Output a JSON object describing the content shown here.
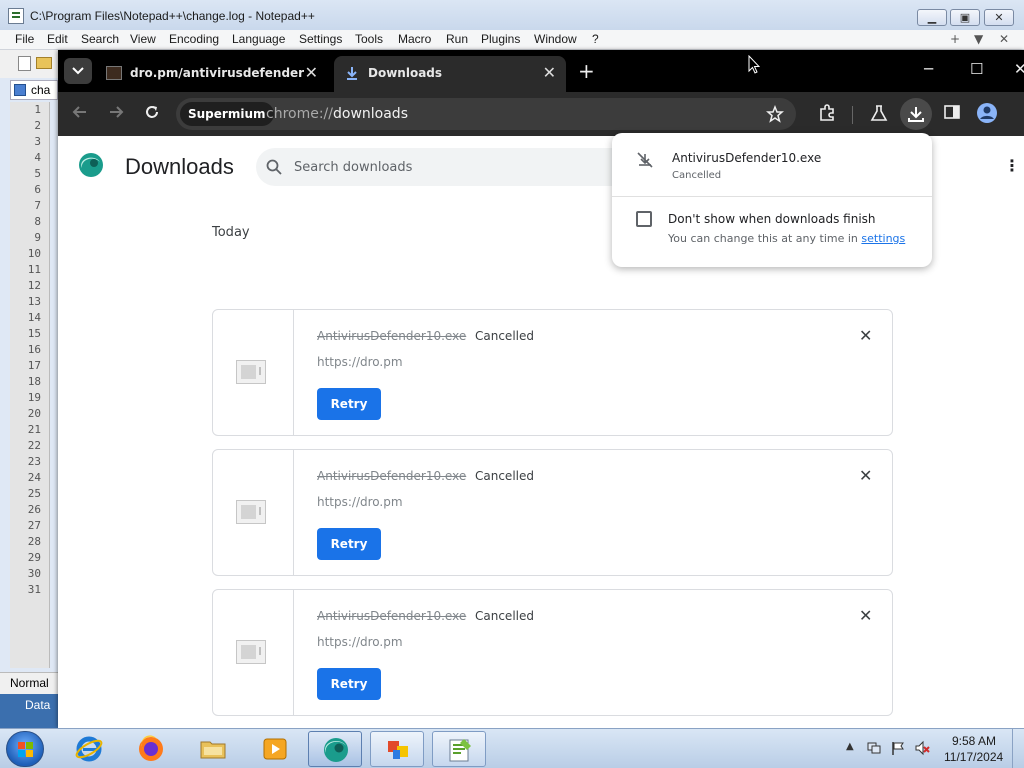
{
  "notepad": {
    "title": "C:\\Program Files\\Notepad++\\change.log - Notepad++",
    "menu": [
      "File",
      "Edit",
      "Search",
      "View",
      "Encoding",
      "Language",
      "Settings",
      "Tools",
      "Macro",
      "Run",
      "Plugins",
      "Window",
      "?"
    ],
    "menu_right": [
      "+",
      "▼",
      "✕"
    ],
    "tab_label": "cha",
    "line_numbers": [
      "1",
      "2",
      "3",
      "4",
      "5",
      "6",
      "7",
      "8",
      "9",
      "10",
      "11",
      "12",
      "13",
      "14",
      "15",
      "16",
      "17",
      "18",
      "19",
      "20",
      "21",
      "22",
      "23",
      "24",
      "25",
      "26",
      "27",
      "28",
      "29",
      "30",
      "31"
    ],
    "status_mode": "Normal",
    "bottom_label": "Data"
  },
  "browser": {
    "tabs": [
      {
        "title": "dro.pm/antivirusdefender",
        "active": false
      },
      {
        "title": "Downloads",
        "active": true
      }
    ],
    "new_tab": "+",
    "address": {
      "chip": "Supermium",
      "url_scheme": "chrome://",
      "url_path": "downloads"
    }
  },
  "downloads_page": {
    "title": "Downloads",
    "search_placeholder": "Search downloads",
    "section_label": "Today",
    "items": [
      {
        "filename": "AntivirusDefender10.exe",
        "status": "Cancelled",
        "url": "https://dro.pm",
        "action": "Retry"
      },
      {
        "filename": "AntivirusDefender10.exe",
        "status": "Cancelled",
        "url": "https://dro.pm",
        "action": "Retry"
      },
      {
        "filename": "AntivirusDefender10.exe",
        "status": "Cancelled",
        "url": "https://dro.pm",
        "action": "Retry"
      }
    ]
  },
  "download_bubble": {
    "filename": "AntivirusDefender10.exe",
    "status": "Cancelled",
    "option_label": "Don't show when downloads finish",
    "option_checked": false,
    "hint_text": "You can change this at any time in ",
    "hint_link": "settings"
  },
  "taskbar": {
    "time": "9:58 AM",
    "date": "11/17/2024",
    "apps": [
      "internet-explorer",
      "firefox",
      "file-explorer",
      "media-player",
      "supermium",
      "app-window",
      "notepad-plus-plus"
    ]
  },
  "colors": {
    "accent": "#1a73e8",
    "tabstrip": "#000000",
    "toolbar": "#2b2b2b"
  }
}
